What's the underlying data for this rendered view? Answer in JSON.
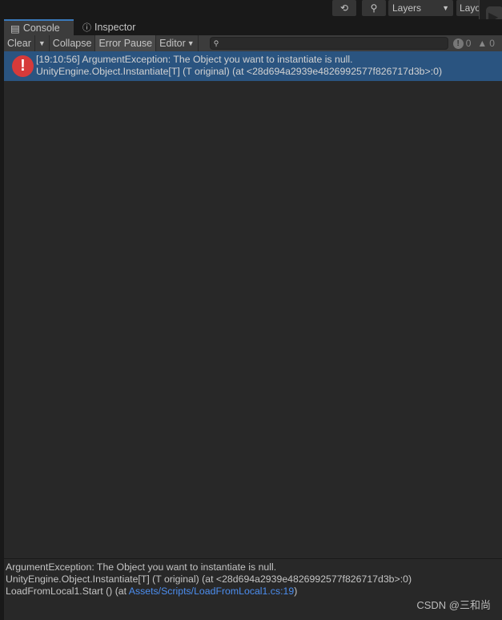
{
  "top": {
    "history_icon": "history-icon",
    "search_icon": "search-icon",
    "layers_label": "Layers",
    "layout_label": "Layo"
  },
  "tabs": [
    {
      "label": "Console",
      "icon": "console-icon",
      "active": true
    },
    {
      "label": "Inspector",
      "icon": "info-icon",
      "active": false
    }
  ],
  "toolbar": {
    "clear": "Clear",
    "collapse": "Collapse",
    "error_pause": "Error Pause",
    "editor": "Editor",
    "search_placeholder": "",
    "error_count": "0",
    "warning_count": "0"
  },
  "log": [
    {
      "type": "error",
      "line1": "[19:10:56] ArgumentException: The Object you want to instantiate is null.",
      "line2": "UnityEngine.Object.Instantiate[T] (T original) (at <28d694a2939e4826992577f826717d3b>:0)",
      "selected": true
    }
  ],
  "detail": {
    "line1": "ArgumentException: The Object you want to instantiate is null.",
    "line2": "UnityEngine.Object.Instantiate[T] (T original) (at <28d694a2939e4826992577f826717d3b>:0)",
    "line3_prefix": "LoadFromLocal1.Start () (at ",
    "line3_link": "Assets/Scripts/LoadFromLocal1.cs:19",
    "line3_suffix": ")"
  },
  "watermark": "CSDN @三和尚",
  "colors": {
    "selected_row": "#2a5480",
    "link": "#4c8ef0",
    "error": "#d63a3a"
  }
}
